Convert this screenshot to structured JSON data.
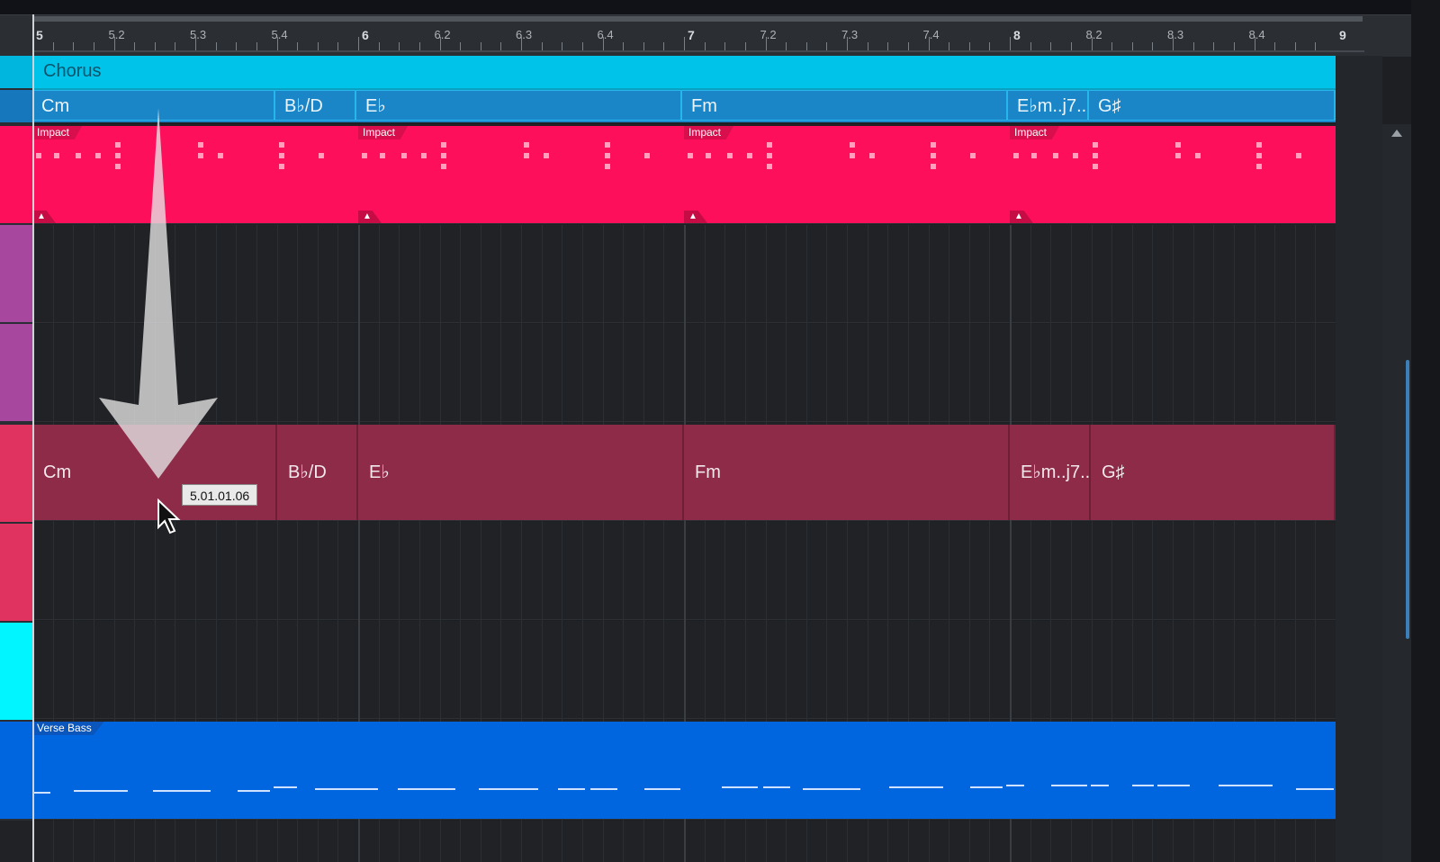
{
  "ruler": {
    "labels": [
      "5",
      "5.2",
      "5.3",
      "5.4",
      "6",
      "6.2",
      "6.3",
      "6.4",
      "7",
      "7.2",
      "7.3",
      "7.4",
      "8",
      "8.2",
      "8.3",
      "8.4",
      "9"
    ]
  },
  "arranger": {
    "section_label": "Chorus",
    "color": "#00c3ea"
  },
  "chord_track": {
    "chords": [
      "Cm",
      "B♭/D",
      "E♭",
      "Fm",
      "E♭m..j7..",
      "G♯"
    ]
  },
  "drum_track": {
    "event_name": "Impact",
    "color": "#fe0f5b"
  },
  "chord_instrument": {
    "chords": [
      "Cm",
      "B♭/D",
      "E♭",
      "Fm",
      "E♭m..j7..",
      "G♯"
    ],
    "color": "#8d2b48"
  },
  "bass_track": {
    "event_name": "Verse Bass",
    "color": "#0066e0"
  },
  "drag_tooltip": {
    "position": "5.01.01.06"
  },
  "icons": {
    "drag_arrow": "down-arrow-icon",
    "cursor": "mouse-pointer-icon",
    "event_foot": "lock-icon",
    "scroll_up": "chevron-up-icon"
  }
}
